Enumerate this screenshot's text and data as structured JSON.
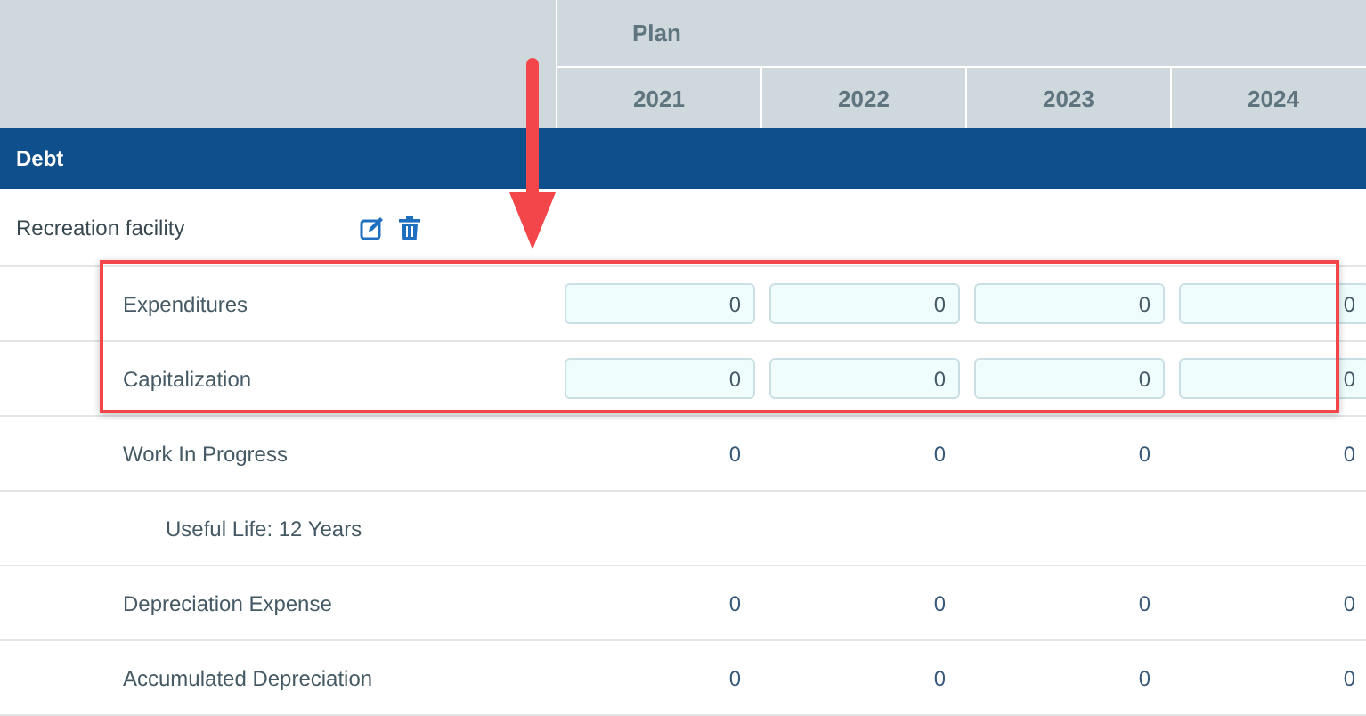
{
  "header": {
    "group": "Plan",
    "years": [
      "2021",
      "2022",
      "2023",
      "2024"
    ]
  },
  "section": {
    "title": "Debt"
  },
  "item": {
    "name": "Recreation facility"
  },
  "rows": [
    {
      "kind": "input",
      "label": "Expenditures",
      "values": [
        "0",
        "0",
        "0",
        "0"
      ]
    },
    {
      "kind": "input",
      "label": "Capitalization",
      "values": [
        "0",
        "0",
        "0",
        "0"
      ]
    },
    {
      "kind": "value",
      "label": "Work In Progress",
      "values": [
        "0",
        "0",
        "0",
        "0"
      ]
    },
    {
      "kind": "note",
      "label": "Useful Life: 12 Years"
    },
    {
      "kind": "value",
      "label": "Depreciation Expense",
      "values": [
        "0",
        "0",
        "0",
        "0"
      ]
    },
    {
      "kind": "value",
      "label": "Accumulated Depreciation",
      "values": [
        "0",
        "0",
        "0",
        "0"
      ]
    }
  ]
}
